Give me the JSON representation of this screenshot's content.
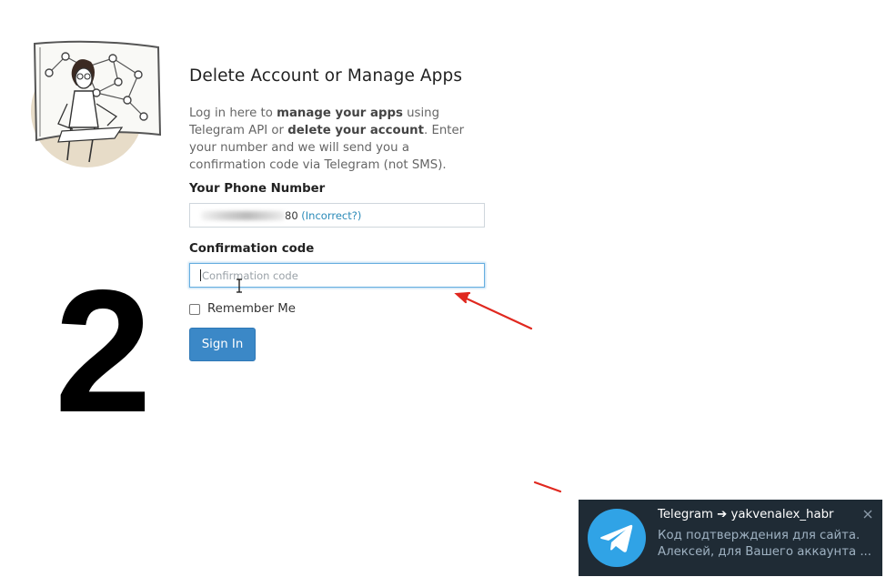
{
  "page": {
    "title": "Delete Account or Manage Apps",
    "lead": {
      "p1": "Log in here to ",
      "b1": "manage your apps",
      "p2": " using Telegram API or ",
      "b2": "delete your account",
      "p3": ". Enter your number and we will send you a confirmation code via Telegram (not SMS)."
    }
  },
  "form": {
    "phone_label": "Your Phone Number",
    "phone_suffix": "80",
    "incorrect_link": "(Incorrect?)",
    "code_label": "Confirmation code",
    "code_value": "",
    "code_placeholder": "Confirmation code",
    "remember_label": "Remember Me",
    "remember_checked": false,
    "sign_in_label": "Sign In"
  },
  "annotation": {
    "step_number": "2",
    "arrow_color": "#e0281f"
  },
  "notification": {
    "title": "Telegram ➔ yakvenalex_habr",
    "line1": "Код подтверждения для сайта.",
    "line2": "Алексей, для Вашего аккаунта ...",
    "icon": "telegram-plane-icon",
    "close_icon": "close-icon"
  },
  "colors": {
    "accent": "#3b88c7",
    "link": "#2a8ab8",
    "toast_bg": "#1f2b35",
    "telegram_blue": "#30a3e6"
  }
}
